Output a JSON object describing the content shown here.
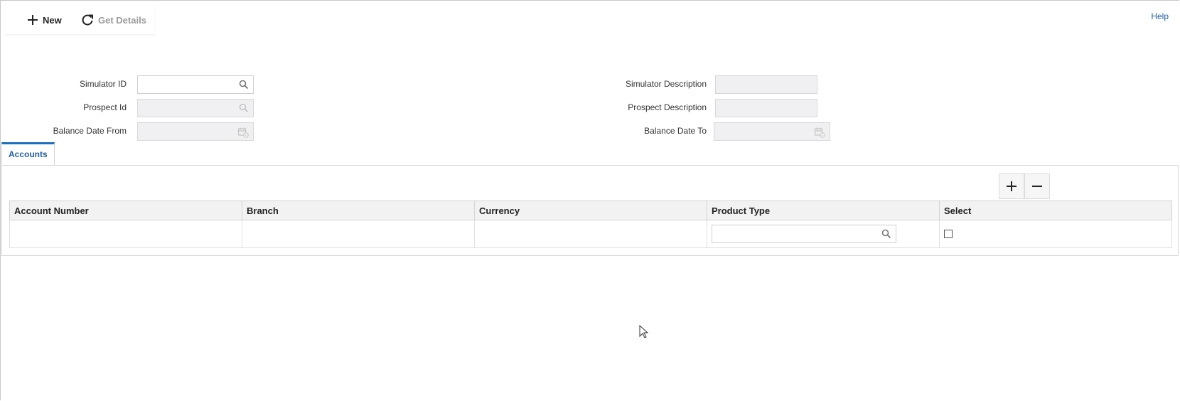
{
  "toolbar": {
    "new_label": "New",
    "get_details_label": "Get Details"
  },
  "help_label": "Help",
  "form": {
    "simulator_id": {
      "label": "Simulator ID",
      "value": ""
    },
    "prospect_id": {
      "label": "Prospect Id",
      "value": ""
    },
    "balance_date_from": {
      "label": "Balance Date From",
      "value": ""
    },
    "simulator_description": {
      "label": "Simulator Description",
      "value": ""
    },
    "prospect_description": {
      "label": "Prospect Description",
      "value": ""
    },
    "balance_date_to": {
      "label": "Balance Date To",
      "value": ""
    }
  },
  "tabs": [
    {
      "label": "Accounts",
      "active": true
    }
  ],
  "grid": {
    "columns": [
      "Account Number",
      "Branch",
      "Currency",
      "Product Type",
      "Select"
    ],
    "rows": [
      {
        "account_number": "",
        "branch": "",
        "currency": "",
        "product_type": "",
        "selected": false
      }
    ]
  },
  "colors": {
    "accent": "#1f6fbf",
    "link": "#1f5ea8",
    "disabled_text": "#9a9a9a",
    "readonly_field": "#f0f0f2",
    "header_bg": "#f2f2f2"
  },
  "icons": {
    "new": "plus-icon",
    "get_details": "refresh-icon",
    "lookup": "search-icon",
    "date": "calendar-icon",
    "add_row": "plus-icon",
    "delete_row": "minus-icon"
  }
}
